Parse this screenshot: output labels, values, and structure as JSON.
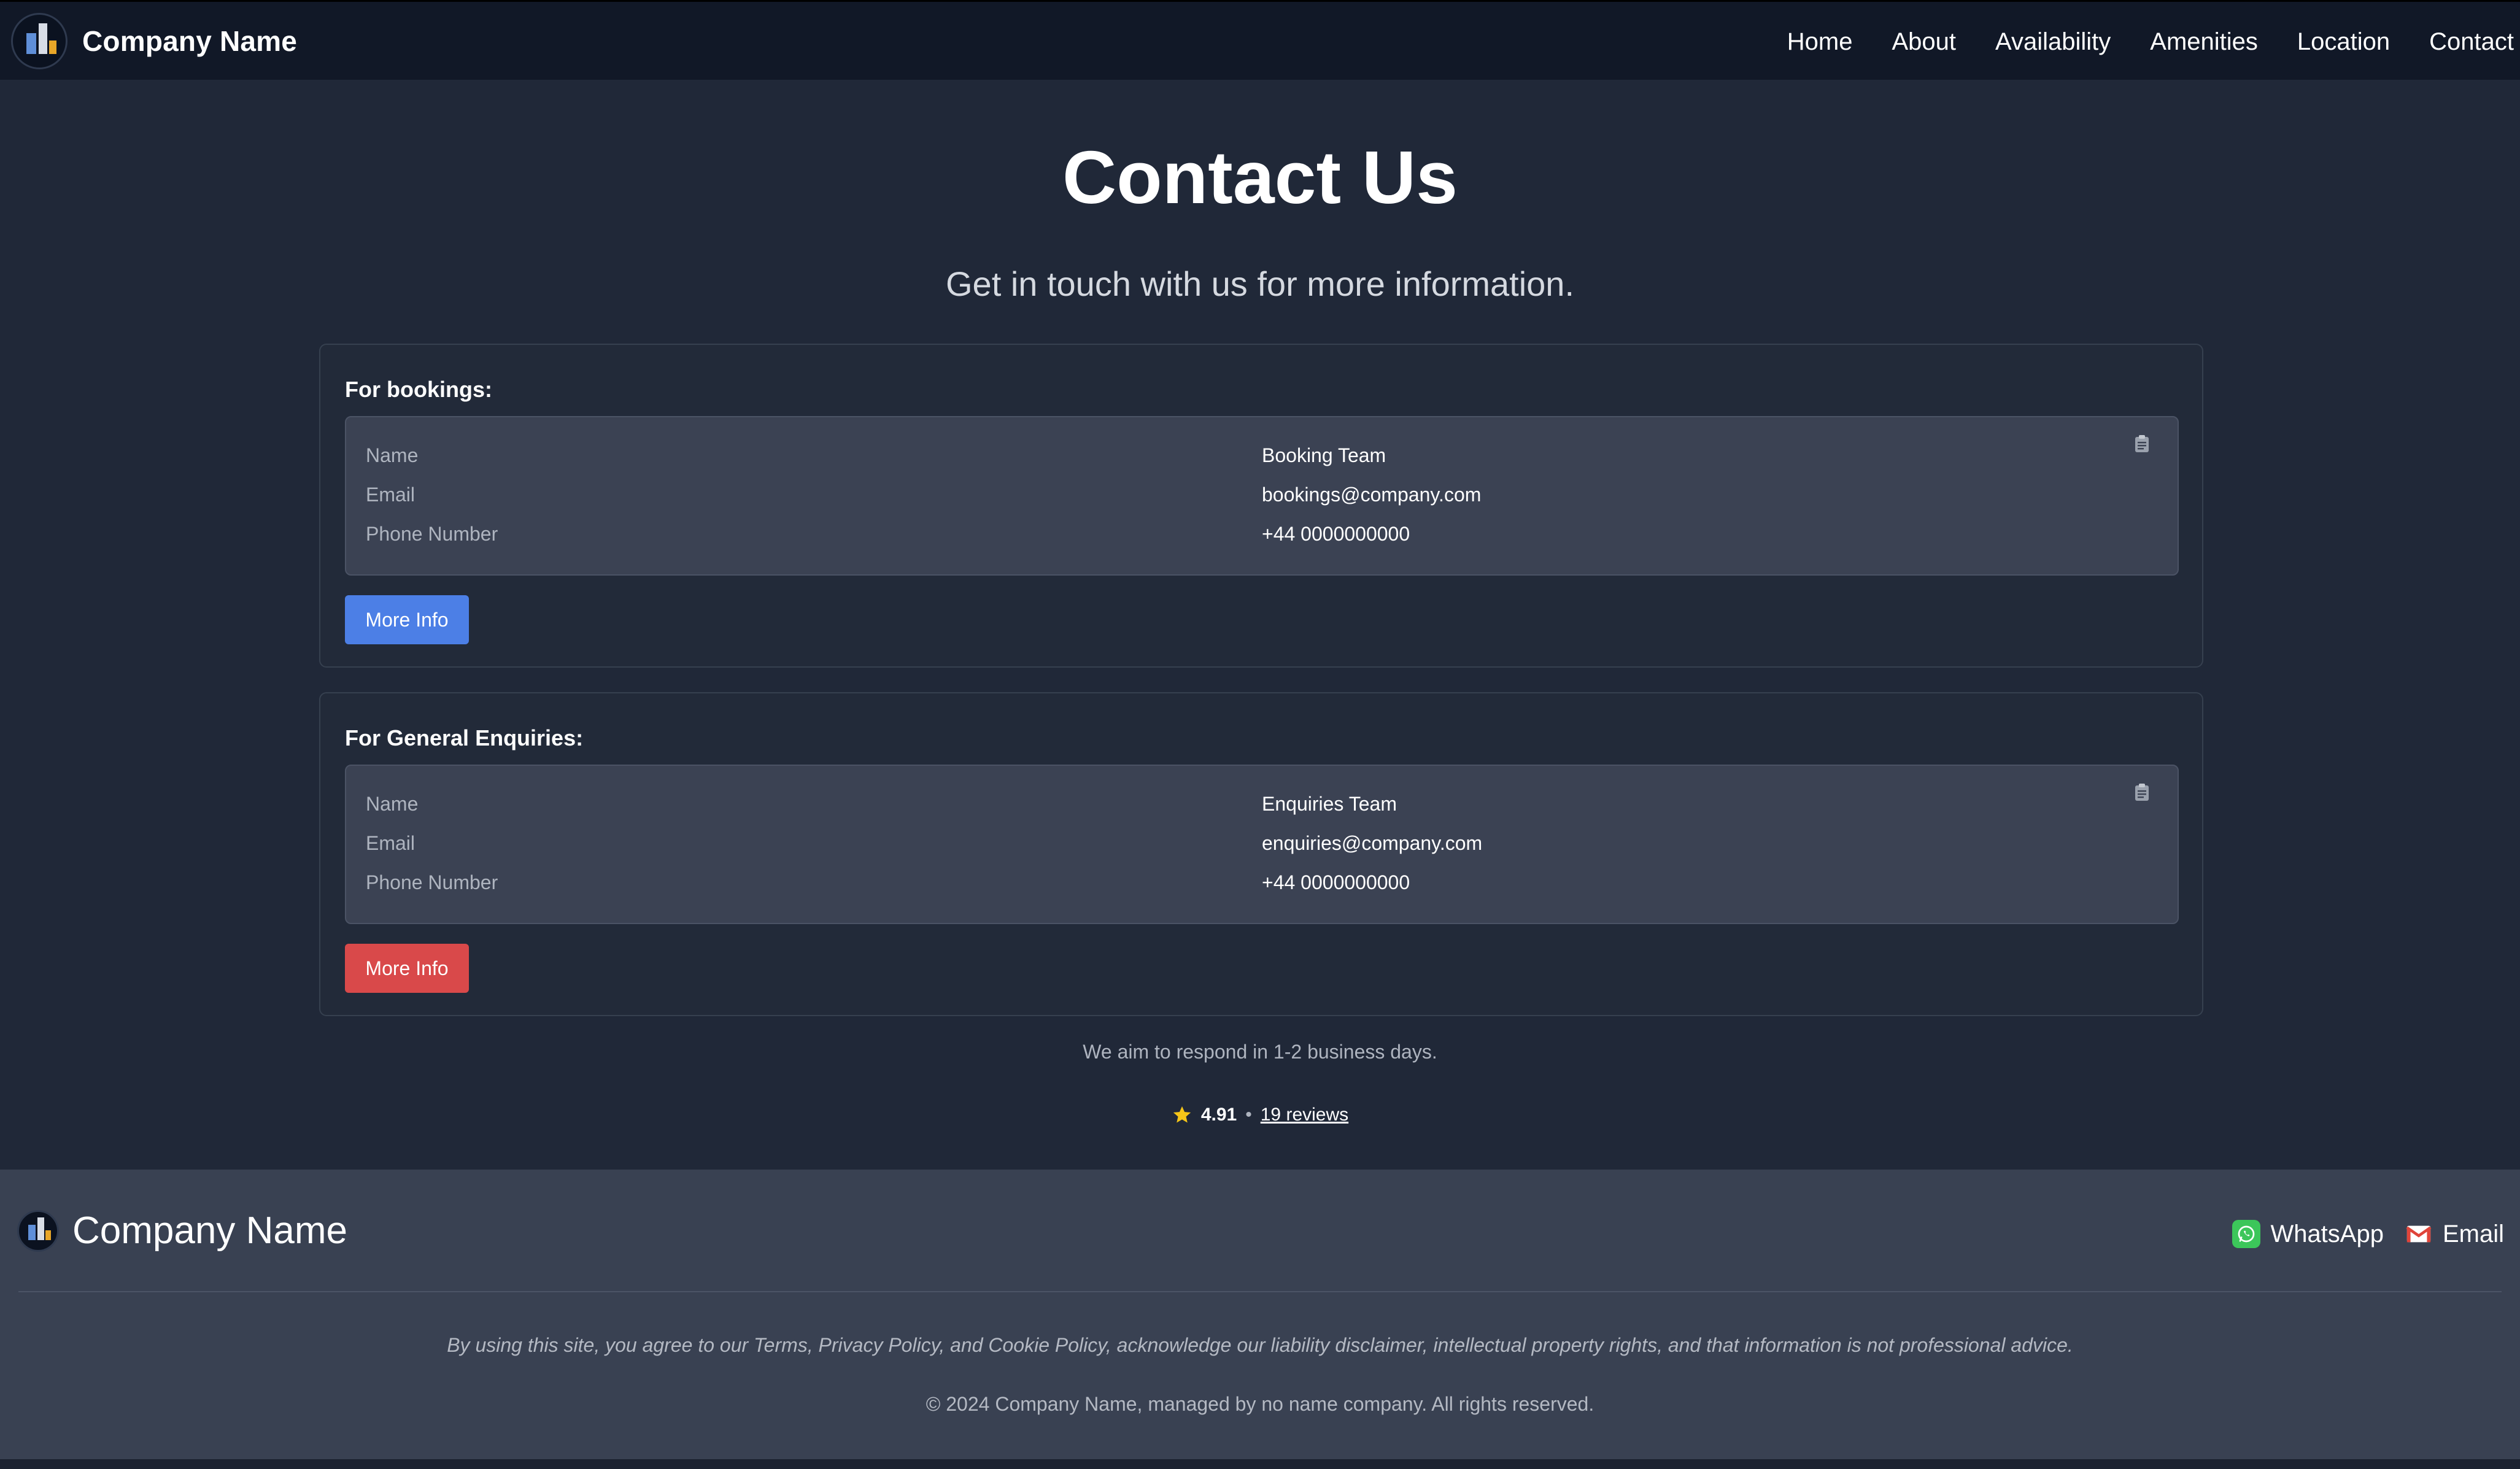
{
  "header": {
    "brand_name": "Company Name",
    "nav": [
      "Home",
      "About",
      "Availability",
      "Amenities",
      "Location",
      "Contact"
    ]
  },
  "hero": {
    "title": "Contact Us",
    "subtitle": "Get in touch with us for more information."
  },
  "bookings": {
    "title": "For bookings:",
    "rows": [
      {
        "label": "Name",
        "value": "Booking Team"
      },
      {
        "label": "Email",
        "value": "bookings@company.com"
      },
      {
        "label": "Phone Number",
        "value": "+44 0000000000"
      }
    ],
    "button_label": "More Info",
    "button_color": "#4c7fe6"
  },
  "enquiries": {
    "title": "For General Enquiries:",
    "rows": [
      {
        "label": "Name",
        "value": "Enquiries Team"
      },
      {
        "label": "Email",
        "value": "enquiries@company.com"
      },
      {
        "label": "Phone Number",
        "value": "+44 0000000000"
      }
    ],
    "button_label": "More Info",
    "button_color": "#d9494a"
  },
  "response_note": "We aim to respond in 1-2 business days.",
  "rating": {
    "score": "4.91",
    "separator": "•",
    "reviews_label": "19 reviews",
    "star_color": "#f5c518"
  },
  "footer": {
    "brand_name": "Company Name",
    "links": {
      "whatsapp": "WhatsApp",
      "email": "Email"
    },
    "legal": "By using this site, you agree to our Terms, Privacy Policy, and Cookie Policy, acknowledge our liability disclaimer, intellectual property rights, and that information is not professional advice.",
    "copyright": "© 2024 Company Name, managed by no name company. All rights reserved."
  },
  "icons": {
    "logo": "building-logo-icon",
    "clipboard": "clipboard-icon",
    "star": "star-icon",
    "whatsapp": "whatsapp-icon",
    "mail": "mail-icon"
  }
}
